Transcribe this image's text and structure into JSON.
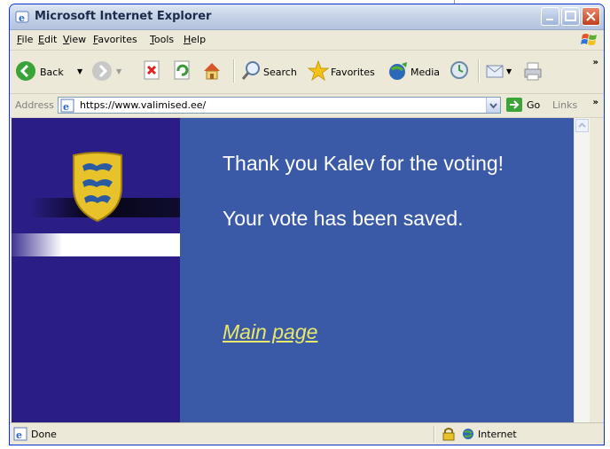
{
  "window": {
    "title": "Microsoft Internet Explorer"
  },
  "menu": {
    "items": [
      "File",
      "Edit",
      "View",
      "Favorites",
      "Tools",
      "Help"
    ]
  },
  "toolbar": {
    "back_label": "Back",
    "search_label": "Search",
    "favorites_label": "Favorites",
    "media_label": "Media"
  },
  "address": {
    "label": "Address",
    "url": "https://www.valimised.ee/",
    "go_label": "Go",
    "links_label": "Links"
  },
  "page": {
    "message_line1": "Thank you Kalev for the voting!",
    "message_line2": "Your vote has been saved.",
    "main_link": "Main page"
  },
  "status": {
    "text": "Done",
    "zone": "Internet"
  },
  "colors": {
    "content_bg": "#3a5aa8",
    "left_panel": "#2a1e86",
    "link": "#e8e86a"
  }
}
